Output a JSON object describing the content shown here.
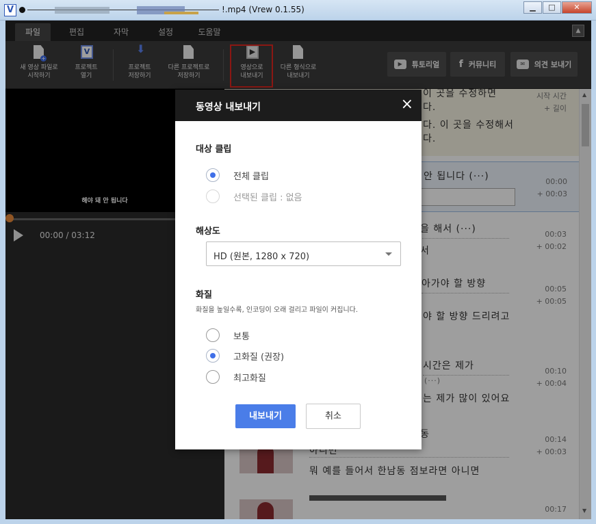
{
  "window": {
    "title": "!.mp4 (Vrew 0.1.55)",
    "app_icon_letter": "V"
  },
  "menu": {
    "tabs": [
      "파일",
      "편집",
      "자막",
      "설정",
      "도움말"
    ],
    "active": "파일"
  },
  "toolbar": {
    "new_project_1": "새 영상 파일로",
    "new_project_2": "시작하기",
    "open_1": "프로젝트",
    "open_2": "열기",
    "save_1": "프로젝트",
    "save_2": "저장하기",
    "save_as_1": "다른 프로젝트로",
    "save_as_2": "저장하기",
    "export_video_1": "영상으로",
    "export_video_2": "내보내기",
    "export_other_1": "다른 형식으로",
    "export_other_2": "내보내기",
    "tutorial": "튜토리얼",
    "community": "커뮤니티",
    "feedback": "의견 보내기"
  },
  "player": {
    "subtitle": "해야 돼 안 됩니다",
    "time": "00:00 / 03:12",
    "progress": 0
  },
  "subtitle_list": {
    "header_time": "시작 시간",
    "header_length": "+ 길이",
    "rows": [
      {
        "line1": "이 곳을 수정하면",
        "line2": "다.",
        "line3": "다. 이 곳을 수정해서",
        "line4": "다."
      },
      {
        "line1": "안 됩니다 (···)",
        "start": "00:00",
        "length": "+ 00:03"
      },
      {
        "line1": "을 해서 (···)",
        "line2": "서",
        "start": "00:03",
        "length": "+ 00:02"
      },
      {
        "line1": "아가야 할 방향",
        "start": "00:05",
        "length": "+ 00:05"
      },
      {
        "line1": "야 할 방향 드리려고",
        "line2": "고"
      },
      {
        "line1": "시간은 제가",
        "line2": "(···)",
        "start": "00:10",
        "length": "+ 00:04"
      },
      {
        "line1": "는 제가 많이 있어요"
      },
      {
        "line1": "동",
        "line2": "아니면",
        "line3": "뭐 예를 들어서 한남동 점보라면 아니면",
        "start": "00:14",
        "length": "+ 00:03"
      },
      {
        "start": "00:17"
      }
    ]
  },
  "dialog": {
    "title": "동영상 내보내기",
    "close_icon": "×",
    "target_label": "대상 클립",
    "target_options": [
      "전체 클립",
      "선택된 클립 : 없음"
    ],
    "target_selected": "전체 클립",
    "resolution_label": "해상도",
    "resolution_value": "HD (원본, 1280 x 720)",
    "quality_label": "화질",
    "quality_note": "화질을 높일수록, 인코딩이 오래 걸리고 파일이 커집니다.",
    "quality_options": [
      "보통",
      "고화질 (권장)",
      "최고화질"
    ],
    "quality_selected": "고화질 (권장)",
    "export_button": "내보내기",
    "cancel_button": "취소"
  },
  "colors": {
    "accent": "#4a7de8",
    "highlight": "#e0261f",
    "dark_bg": "#2b2b2b"
  }
}
